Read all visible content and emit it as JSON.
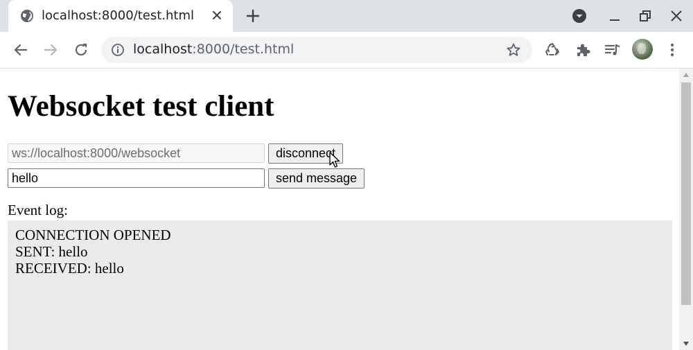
{
  "browser": {
    "tab": {
      "title": "localhost:8000/test.html"
    },
    "url": {
      "host": "localhost",
      "rest": ":8000/test.html"
    },
    "icons": {
      "favicon": "globe-icon",
      "tab_close": "close-icon",
      "new_tab": "plus-icon",
      "tab_search": "tab-search-icon",
      "minimize": "minimize-icon",
      "restore": "restore-icon",
      "close": "close-icon",
      "back": "back-arrow-icon",
      "forward": "forward-arrow-icon",
      "reload": "reload-icon",
      "site_info": "info-icon",
      "bookmark": "star-icon",
      "recycle_extension": "recycle-icon",
      "extensions": "puzzle-icon",
      "media": "playlist-icon",
      "menu": "kebab-menu-icon"
    }
  },
  "page": {
    "title": "Websocket test client",
    "ws_url_value": "ws://localhost:8000/websocket",
    "disconnect_label": "disconnect",
    "message_value": "hello",
    "send_label": "send message",
    "log_label": "Event log:",
    "log_entries": [
      "CONNECTION OPENED",
      "SENT: hello",
      "RECEIVED: hello"
    ]
  },
  "colors": {
    "tabstrip_bg": "#dee1e6",
    "omnibox_bg": "#f1f3f4",
    "log_bg": "#ebebeb",
    "button_bg": "#efefef",
    "icon_color": "#5f6368"
  }
}
